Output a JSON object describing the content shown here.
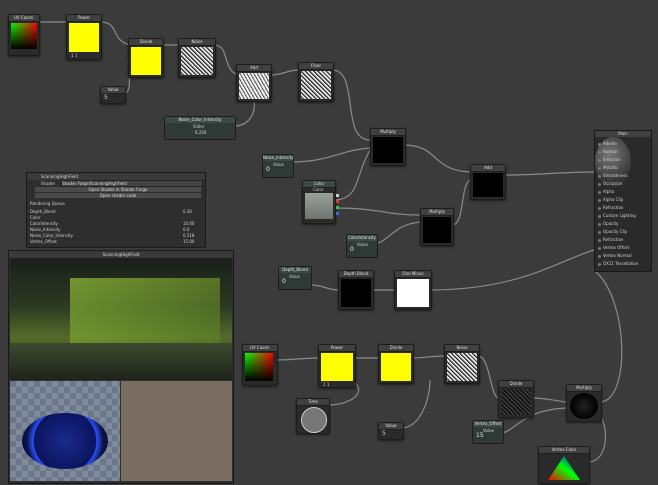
{
  "nodes": {
    "uv_coord_top": {
      "title": "UV Coord."
    },
    "power_top": {
      "title": "Power",
      "ports": "1 1"
    },
    "stretch_top": {
      "title": "Divide"
    },
    "noise_top": {
      "title": "Noise"
    },
    "add_top": {
      "title": "Add"
    },
    "ghost_top": {
      "title": "Floor"
    },
    "value_top": {
      "title": "Value",
      "value": "5"
    },
    "noise_color_intensity": {
      "title": "Noise_Color_Intensity",
      "sub": "Slider",
      "value": "0.250"
    },
    "multiply_a": {
      "title": "Multiply"
    },
    "noise_intensity": {
      "title": "Noise_Intensity",
      "sub": "Value",
      "value": "0"
    },
    "color_node": {
      "title": "Color",
      "sub": "Color"
    },
    "add_mid": {
      "title": "Add"
    },
    "multiply_b": {
      "title": "Multiply"
    },
    "color_intensity": {
      "title": "ColorIntensity",
      "sub": "Value",
      "value": "0"
    },
    "depth_blend_prop": {
      "title": "Depth_Blend",
      "sub": "Value",
      "value": "0"
    },
    "depth_blend_node": {
      "title": "Depth Blend"
    },
    "one_minus": {
      "title": "One Minus"
    },
    "uv_coord_bottom": {
      "title": "UV Coord."
    },
    "power_bottom": {
      "title": "Power",
      "ports": "1 1"
    },
    "divide_bottom": {
      "title": "Divide"
    },
    "noise_bottom": {
      "title": "Noise"
    },
    "time_node": {
      "title": "Time"
    },
    "value_bottom": {
      "title": "Value",
      "value": "5"
    },
    "divide_small": {
      "title": "Divide"
    },
    "vertex_offset": {
      "title": "Vertex_Offset",
      "sub": "Value",
      "value": "15"
    },
    "multiply_c": {
      "title": "Multiply"
    },
    "vertex_color": {
      "title": "Vertex Color"
    }
  },
  "output": {
    "title": "Main",
    "rows": [
      "Albedo",
      "Normal",
      "Emission",
      "Metallic",
      "Smoothness",
      "Occlusion",
      "Alpha",
      "Alpha Clip",
      "Refraction",
      "Custom Lighting",
      "Opacity",
      "Opacity Clip",
      "Refraction",
      "Vertex Offset",
      "Vertex Normal",
      "DX11 Tessellation"
    ]
  },
  "inspector": {
    "title": "ScanningHighField",
    "shader_label": "Shader",
    "shader_value": "Shader Forge/ScanningHighField",
    "btn1": "Open Shader in Shader Forge",
    "btn2": "Open shader code",
    "section": "Rendering Queue",
    "props": [
      {
        "name": "Depth_Blend",
        "value": "0.30"
      },
      {
        "name": "Color",
        "value": ""
      },
      {
        "name": "ColorIntensity",
        "value": "10.00"
      },
      {
        "name": "Noise_Intensity",
        "value": "0.0"
      },
      {
        "name": "Noise_Color_Intensity",
        "value": "0.518"
      },
      {
        "name": "Vertex_Offset",
        "value": "15.00"
      }
    ]
  },
  "preview": {
    "title": "ScanningHighField"
  },
  "colors": {
    "accent_yellow": "#ffff00",
    "bg": "#3b3b3b",
    "prop_green": "#2f3a36"
  }
}
